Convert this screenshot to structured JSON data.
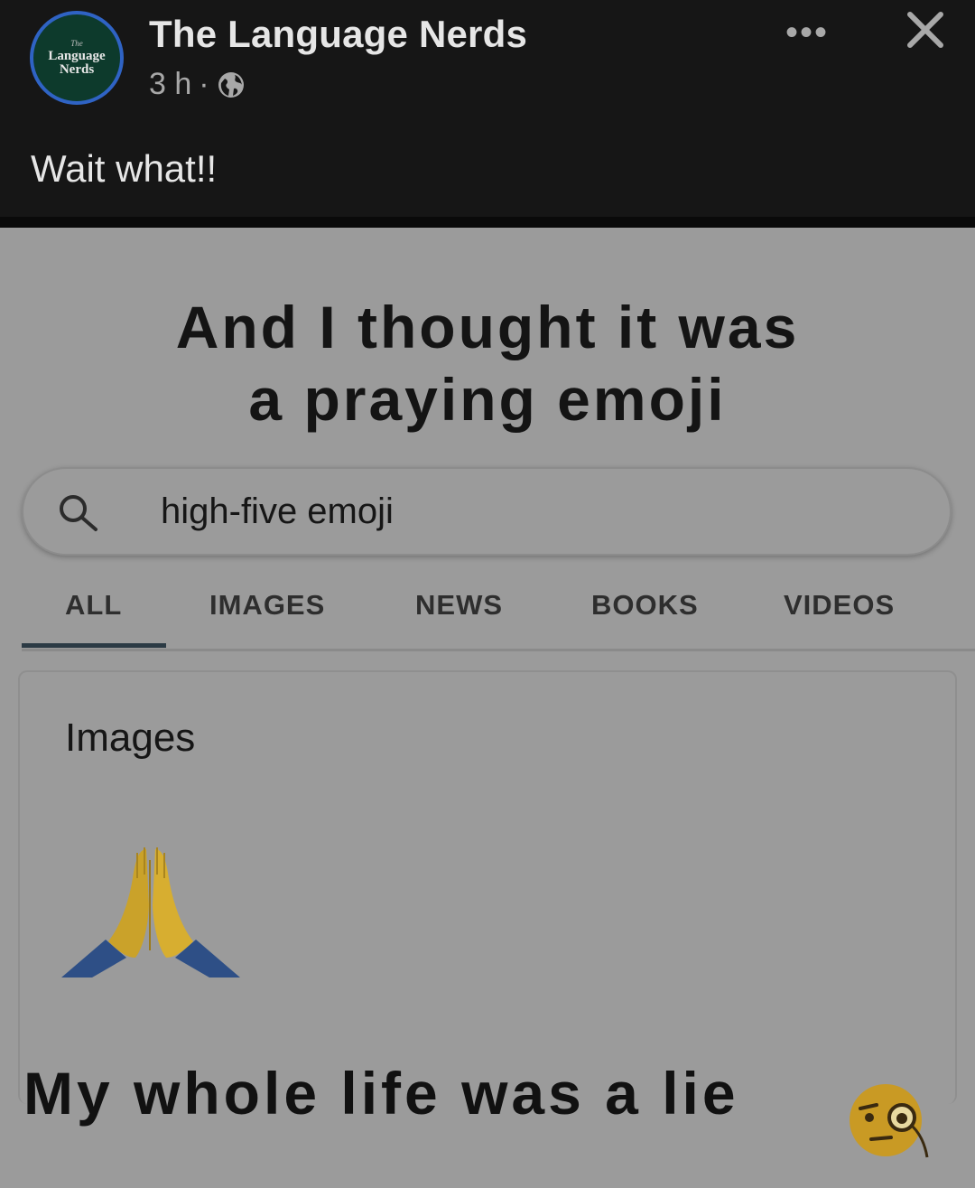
{
  "post": {
    "avatar": {
      "line_the": "The",
      "line1": "Language",
      "line2": "Nerds"
    },
    "page_name": "The Language Nerds",
    "time": "3 h",
    "separator": "·",
    "audience_icon": "globe-icon",
    "more_icon": "more-icon",
    "more_label": "•••",
    "close_icon": "close-icon",
    "caption": "Wait what!!"
  },
  "meme": {
    "title_line1": "And I thought it was",
    "title_line2": "a praying emoji",
    "search": {
      "icon": "search-icon",
      "query": "high-five emoji"
    },
    "tabs": [
      "ALL",
      "IMAGES",
      "NEWS",
      "BOOKS",
      "VIDEOS"
    ],
    "active_tab": "ALL",
    "card_title": "Images",
    "result_emoji": "folded-hands-emoji",
    "bottom_text": "My whole life was a lie",
    "bottom_emoji": "face-with-monocle-emoji"
  },
  "colors": {
    "header_bg": "#161616",
    "meme_bg": "#9b9b9b",
    "avatar_ring": "#2f63c4",
    "avatar_fill": "#0d3a2c"
  }
}
